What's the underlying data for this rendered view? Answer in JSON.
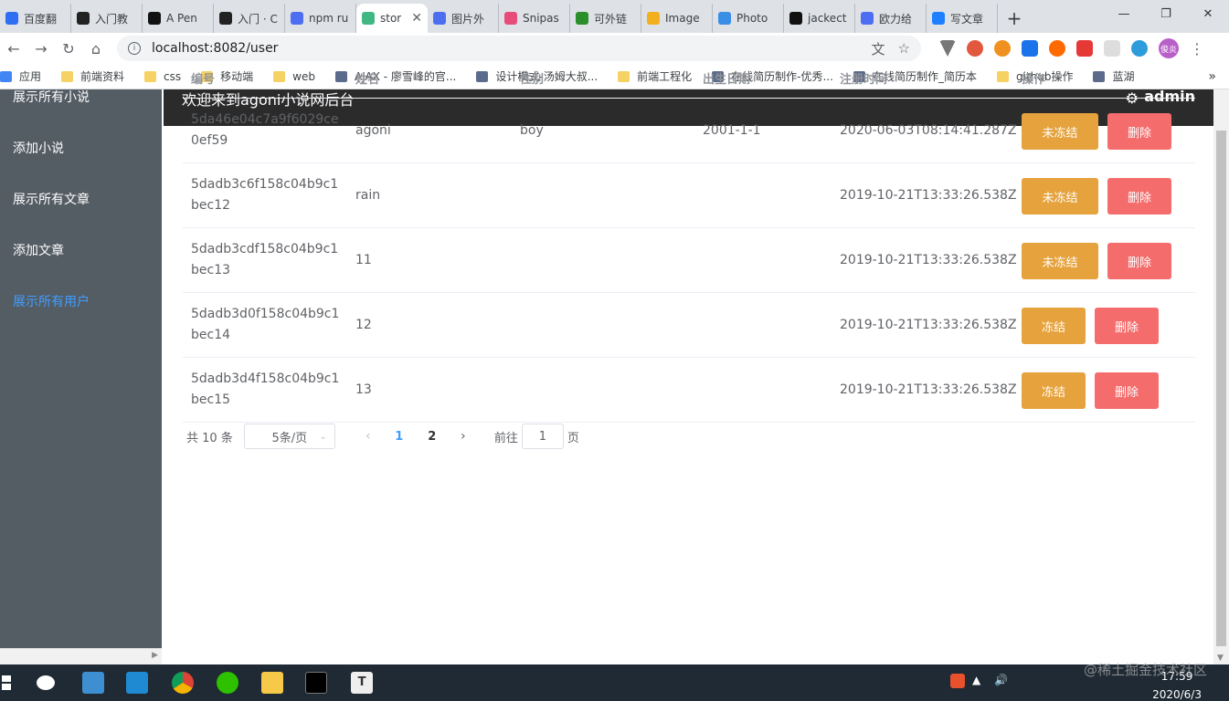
{
  "browser": {
    "tabs": [
      {
        "label": "百度翻",
        "color": "#2f6ef3"
      },
      {
        "label": "入门教",
        "color": "#222222"
      },
      {
        "label": "A Pen",
        "color": "#111111"
      },
      {
        "label": "入门 · C",
        "color": "#222222"
      },
      {
        "label": "npm ru",
        "color": "#4e6ef2"
      },
      {
        "label": "stor",
        "color": "#41b883",
        "active": true
      },
      {
        "label": "图片外",
        "color": "#4e6ef2"
      },
      {
        "label": "Snipas",
        "color": "#e84d7a"
      },
      {
        "label": "可外链",
        "color": "#2a8f2a"
      },
      {
        "label": "Image",
        "color": "#f2b01e"
      },
      {
        "label": "Photo",
        "color": "#3a8ee6"
      },
      {
        "label": "jackect",
        "color": "#111111"
      },
      {
        "label": "欧力给",
        "color": "#4e6ef2"
      },
      {
        "label": "写文章",
        "color": "#1e80ff"
      }
    ],
    "url": "localhost:8082/user",
    "avatar_text": "俊炎",
    "bookmarks": [
      {
        "label": "应用",
        "type": "apps"
      },
      {
        "label": "前端资料",
        "type": "folder"
      },
      {
        "label": "css",
        "type": "folder"
      },
      {
        "label": "移动端",
        "type": "folder"
      },
      {
        "label": "web",
        "type": "folder"
      },
      {
        "label": "AJAX - 廖雪峰的官...",
        "type": "link"
      },
      {
        "label": "设计模式-汤姆大叔...",
        "type": "link"
      },
      {
        "label": "前端工程化",
        "type": "folder"
      },
      {
        "label": "在线简历制作-优秀...",
        "type": "link"
      },
      {
        "label": "在线简历制作_简历本",
        "type": "link"
      },
      {
        "label": "github操作",
        "type": "folder"
      },
      {
        "label": "蓝湖",
        "type": "link"
      }
    ]
  },
  "sidebar": {
    "items": [
      {
        "label": "展示所有小说",
        "active": false
      },
      {
        "label": "添加小说",
        "active": false
      },
      {
        "label": "展示所有文章",
        "active": false
      },
      {
        "label": "添加文章",
        "active": false
      },
      {
        "label": "展示所有用户",
        "active": true
      }
    ]
  },
  "header": {
    "title": "欢迎来到agoni小说网后台",
    "username": "admin"
  },
  "table": {
    "columns": [
      "编号",
      "姓名",
      "性别",
      "出生日期",
      "注册时间",
      "操作"
    ],
    "rows": [
      {
        "id": "5da46e04c7a9f6029ce0ef59",
        "name": "agoni",
        "gender": "boy",
        "birth": "2001-1-1",
        "registered": "2020-06-03T08:14:41.287Z",
        "freeze_label": "未冻结",
        "delete_label": "删除"
      },
      {
        "id": "5dadb3c6f158c04b9c1bec12",
        "name": "rain",
        "gender": "",
        "birth": "",
        "registered": "2019-10-21T13:33:26.538Z",
        "freeze_label": "未冻结",
        "delete_label": "删除"
      },
      {
        "id": "5dadb3cdf158c04b9c1bec13",
        "name": "11",
        "gender": "",
        "birth": "",
        "registered": "2019-10-21T13:33:26.538Z",
        "freeze_label": "未冻结",
        "delete_label": "删除"
      },
      {
        "id": "5dadb3d0f158c04b9c1bec14",
        "name": "12",
        "gender": "",
        "birth": "",
        "registered": "2019-10-21T13:33:26.538Z",
        "freeze_label": "冻结",
        "delete_label": "删除"
      },
      {
        "id": "5dadb3d4f158c04b9c1bec15",
        "name": "13",
        "gender": "",
        "birth": "",
        "registered": "2019-10-21T13:33:26.538Z",
        "freeze_label": "冻结",
        "delete_label": "删除"
      }
    ]
  },
  "pagination": {
    "total_label": "共 10 条",
    "page_size": "5条/页",
    "pages": [
      "1",
      "2"
    ],
    "current_page": "1",
    "goto_prefix": "前往",
    "goto_value": "1",
    "goto_suffix": "页"
  },
  "taskbar": {
    "time": "17:59",
    "date": "2020/6/3",
    "watermark": "@稀土掘金技术社区"
  },
  "colors": {
    "sidebar_bg": "#545c64",
    "active_link": "#409eff",
    "freeze_btn": "#e6a23c",
    "delete_btn": "#f56c6c",
    "header_bg": "#2b2b2b"
  }
}
